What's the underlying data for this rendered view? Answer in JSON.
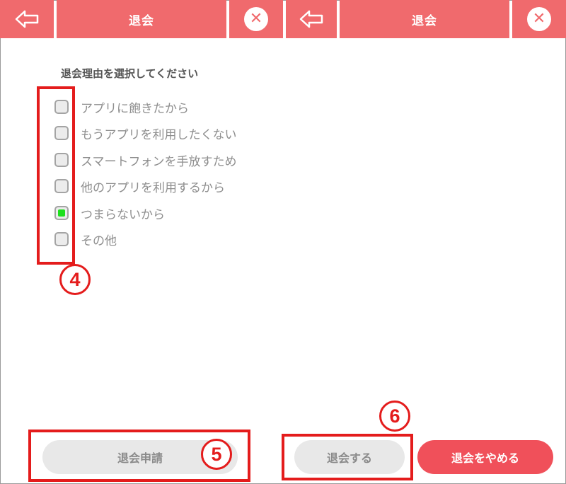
{
  "header": {
    "title_left": "退会",
    "title_right": "退会",
    "back_icon": "arrow-left-icon",
    "close_icon": "close-circle-icon",
    "color": "#f06a6d"
  },
  "form": {
    "prompt": "退会理由を選択してください",
    "options": [
      {
        "label": "アプリに飽きたから",
        "checked": false
      },
      {
        "label": "もうアプリを利用したくない",
        "checked": false
      },
      {
        "label": "スマートフォンを手放すため",
        "checked": false
      },
      {
        "label": "他のアプリを利用するから",
        "checked": false
      },
      {
        "label": "つまらないから",
        "checked": true
      },
      {
        "label": "その他",
        "checked": false
      }
    ]
  },
  "buttons": {
    "apply": "退会申請",
    "confirm": "退会する",
    "cancel": "退会をやめる"
  },
  "annotations": {
    "n4": "4",
    "n5": "5",
    "n6": "6",
    "color": "#e41c1c"
  }
}
